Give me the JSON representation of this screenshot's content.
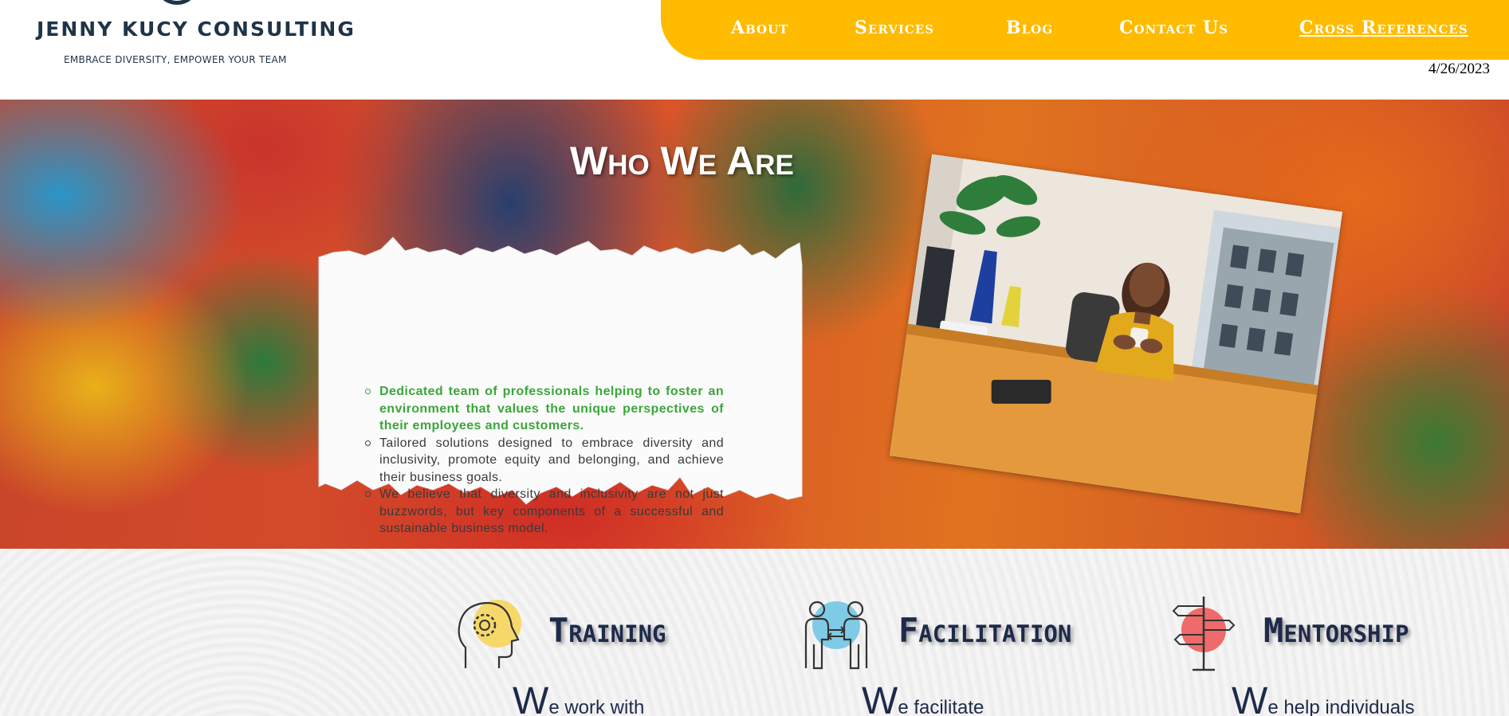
{
  "brand": {
    "name": "JENNY KUCY CONSULTING",
    "tagline": "EMBRACE DIVERSITY, EMPOWER YOUR TEAM"
  },
  "nav": {
    "items": [
      {
        "label": "About"
      },
      {
        "label": "Services"
      },
      {
        "label": "Blog"
      },
      {
        "label": "Contact Us"
      },
      {
        "label": "Cross References"
      }
    ]
  },
  "header": {
    "date": "4/26/2023"
  },
  "hero": {
    "title": "Who We Are",
    "points": [
      "Dedicated team of professionals helping to foster an environment that values the unique perspectives of their employees and customers.",
      "Tailored solutions designed to embrace diversity and inclusivity, promote equity and belonging, and achieve their business goals.",
      "We believe that diversity and inclusivity are not just buzzwords, but key components of a successful and sustainable business model."
    ]
  },
  "services": {
    "items": [
      {
        "title": "Training",
        "text_first": "W",
        "text_rest": "e work with",
        "icon": "head-gear-icon"
      },
      {
        "title": "Facilitation",
        "text_first": "W",
        "text_rest": "e facilitate",
        "icon": "people-exchange-icon"
      },
      {
        "title": "Mentorship",
        "text_first": "W",
        "text_rest": "e help individuals",
        "icon": "signpost-icon"
      }
    ]
  },
  "colors": {
    "accent": "#ffbb00",
    "navy": "#1f3448",
    "green_text": "#3aa63a"
  }
}
